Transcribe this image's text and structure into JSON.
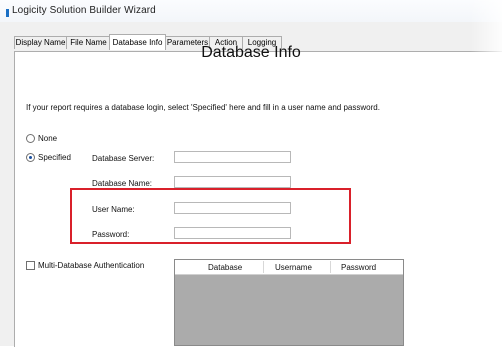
{
  "window": {
    "title": "Logicity Solution Builder Wizard"
  },
  "tabs": [
    {
      "label": "Display Name"
    },
    {
      "label": "File Name"
    },
    {
      "label": "Database Info"
    },
    {
      "label": "Parameters"
    },
    {
      "label": "Action"
    },
    {
      "label": "Logging"
    }
  ],
  "active_tab": "Database Info",
  "page": {
    "heading": "Database Info",
    "description": "If your report requires a database login, select 'Specified' here and fill in a user name and password."
  },
  "login_mode": {
    "options": [
      {
        "label": "None",
        "checked": false
      },
      {
        "label": "Specified",
        "checked": true
      }
    ]
  },
  "fields": {
    "server_label": "Database Server:",
    "server_value": "",
    "name_label": "Database Name:",
    "name_value": "",
    "user_label": "User Name:",
    "user_value": "",
    "password_label": "Password:",
    "password_value": ""
  },
  "multi_db": {
    "label": "Multi-Database Authentication",
    "checked": false,
    "columns": [
      "Database",
      "Username",
      "Password"
    ]
  },
  "colors": {
    "highlight": "#d9202a",
    "accent": "#1a6fc4",
    "grid_background": "#ababab"
  }
}
